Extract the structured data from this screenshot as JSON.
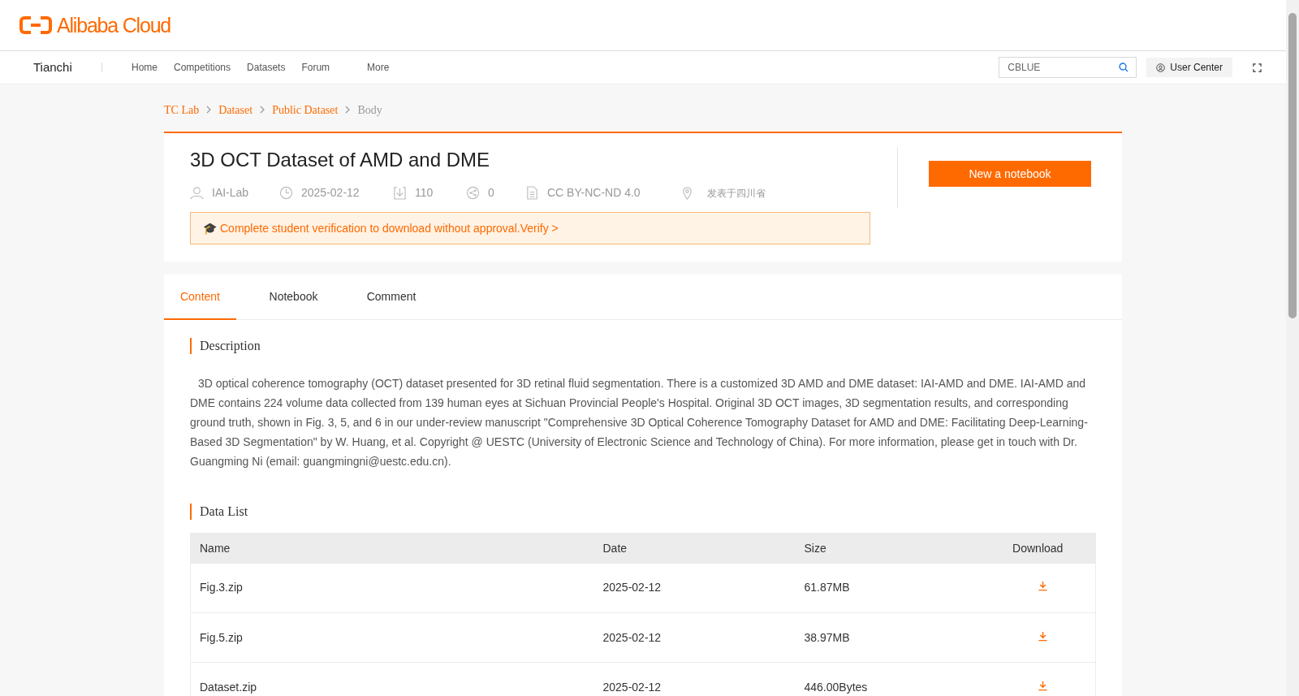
{
  "brand": {
    "logo_text": "Alibaba Cloud"
  },
  "nav": {
    "site": "Tianchi",
    "items": [
      "Home",
      "Competitions",
      "Datasets",
      "Forum",
      "More"
    ],
    "search": {
      "value": "CBLUE"
    },
    "user_button": "User Center"
  },
  "breadcrumb": [
    {
      "label": "TC Lab",
      "link": true
    },
    {
      "label": "Dataset",
      "link": true
    },
    {
      "label": "Public Dataset",
      "link": true
    },
    {
      "label": "Body",
      "link": false
    }
  ],
  "dataset": {
    "title": "3D OCT Dataset of AMD and DME",
    "meta": [
      {
        "kind": "author",
        "text": "IAI-Lab"
      },
      {
        "kind": "date",
        "text": "2025-02-12"
      },
      {
        "kind": "downloads",
        "text": "110"
      },
      {
        "kind": "shares",
        "text": "0"
      },
      {
        "kind": "license",
        "text": "CC BY-NC-ND 4.0"
      },
      {
        "kind": "location",
        "text": "发表于四川省"
      }
    ],
    "notice": {
      "icon": "🎓",
      "text": "Complete student verification to download without approval.",
      "link": "Verify >"
    },
    "action_button": "New a notebook"
  },
  "tabs": [
    {
      "label": "Content",
      "selected": true
    },
    {
      "label": "Notebook",
      "selected": false
    },
    {
      "label": "Comment",
      "selected": false
    }
  ],
  "description": {
    "heading": "Description",
    "text": "3D optical coherence tomography (OCT) dataset presented for 3D retinal fluid segmentation. There is a customized 3D AMD and DME dataset: IAI-AMD and DME. IAI-AMD and DME contains 224 volume data collected from 139 human eyes at Sichuan Provincial People's Hospital. Original 3D OCT images, 3D segmentation results, and corresponding ground truth, shown in Fig. 3, 5, and 6 in our under-review manuscript \"Comprehensive 3D Optical Coherence Tomography Dataset for AMD and DME: Facilitating Deep-Learning-Based 3D Segmentation\" by W. Huang, et al. Copyright @ UESTC (University of Electronic Science and Technology of China). For more information, please get in touch with Dr. Guangming Ni (email: guangmingni@uestc.edu.cn)."
  },
  "data_list": {
    "heading": "Data List",
    "columns": [
      "Name",
      "Date",
      "Size",
      "Download"
    ],
    "rows": [
      {
        "name": "Fig.3.zip",
        "date": "2025-02-12",
        "size": "61.87MB"
      },
      {
        "name": "Fig.5.zip",
        "date": "2025-02-12",
        "size": "38.97MB"
      },
      {
        "name": "Dataset.zip",
        "date": "2025-02-12",
        "size": "446.00Bytes"
      }
    ]
  }
}
